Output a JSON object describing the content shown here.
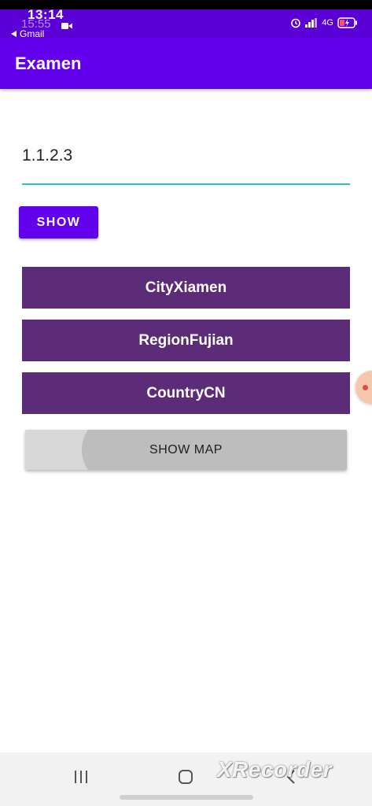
{
  "status_bar": {
    "time": "13:14",
    "time_overlay": "15:55",
    "back_app": "Gmail",
    "network": "4G",
    "icons": [
      "alarm-icon",
      "signal-icon",
      "battery-icon"
    ]
  },
  "app_bar": {
    "title": "Examen"
  },
  "ip_input": {
    "value": "1.1.2.3"
  },
  "show_button": {
    "label": "SHOW"
  },
  "info": {
    "city": "CityXiamen",
    "region": "RegionFujian",
    "country": "CountryCN"
  },
  "map_button": {
    "label": "SHOW MAP"
  },
  "nav_bar": {
    "watermark": "XRecorder",
    "buttons": [
      "recent-apps-icon",
      "home-icon",
      "back-icon"
    ]
  },
  "colors": {
    "primary": "#6200ee",
    "status_bar": "#5a00d6",
    "info_bar": "#5c2c78",
    "input_underline": "#26c6b8",
    "map_button": "#d7d7d7"
  }
}
